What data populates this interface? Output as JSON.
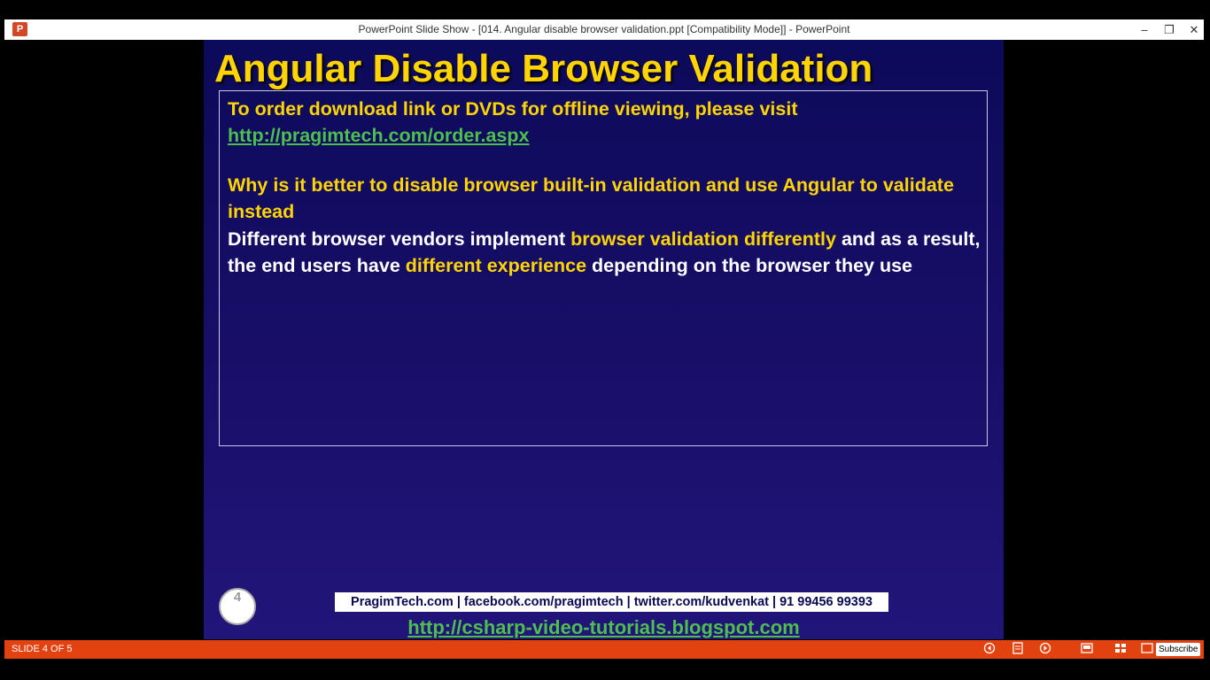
{
  "window": {
    "title": "PowerPoint Slide Show - [014. Angular disable browser validation.ppt [Compatibility Mode]] - PowerPoint",
    "app_icon_text": "P",
    "minimize_glyph": "–",
    "restore_glyph": "❐",
    "close_glyph": "✕"
  },
  "slide": {
    "title": "Angular Disable Browser Validation",
    "order_text": "To order download link or DVDs for offline viewing, please visit",
    "order_link": "http://pragimtech.com/order.aspx",
    "question": "Why is it better to disable browser built-in validation and use Angular to validate instead",
    "answer": {
      "part1": "Different browser vendors implement ",
      "part2": "browser validation differently",
      "part3": " and as a result, the end users have ",
      "part4": "different experience",
      "part5": " depending on the browser they use"
    },
    "slide_number": "4",
    "footer_info": "PragimTech.com | facebook.com/pragimtech  | twitter.com/kudvenkat  | 91 99456 99393",
    "footer_link": "http://csharp-video-tutorials.blogspot.com"
  },
  "statusbar": {
    "slide_counter": "SLIDE 4 OF 5",
    "icons": [
      "previous-icon",
      "menu-icon",
      "next-icon",
      "normal-view-icon",
      "slide-sorter-icon",
      "reading-view-icon"
    ],
    "subscribe_label": "Subscribe"
  },
  "colors": {
    "title_yellow": "#ffd400",
    "link_green": "#4dbf4d",
    "statusbar": "#e1420f",
    "slide_bg": "#0c0a5a"
  }
}
